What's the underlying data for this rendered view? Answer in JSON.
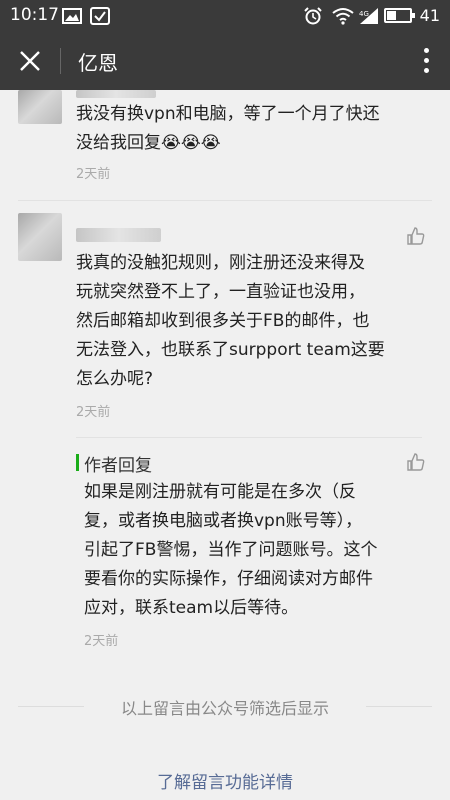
{
  "status_bar": {
    "time": "10:17",
    "signal_label": "4G",
    "battery": "41",
    "battery_level_percent": 41
  },
  "header": {
    "title": "亿恩"
  },
  "comments": [
    {
      "text_lines": [
        "我没有换vpn和电脑，等了一个月了快还",
        "没给我回复😭😭😭"
      ],
      "time": "2天前"
    },
    {
      "text_lines": [
        "我真的没触犯规则，刚注册还没来得及",
        "玩就突然登不上了，一直验证也没用，",
        "然后邮箱却收到很多关于FB的邮件，也",
        "无法登入，也联系了surpport team这要",
        "怎么办呢?"
      ],
      "time": "2天前"
    }
  ],
  "author_reply": {
    "label": "作者回复",
    "text_lines": [
      "如果是刚注册就有可能是在多次（反",
      "复，或者换电脑或者换vpn账号等），",
      "引起了FB警惕，当作了问题账号。这个",
      "要看你的实际操作，仔细阅读对方邮件",
      "应对，联系team以后等待。"
    ],
    "time": "2天前"
  },
  "footer": {
    "note": "以上留言由公众号筛选后显示",
    "link": "了解留言功能详情"
  },
  "colors": {
    "header_bg": "#3a3a3a",
    "page_bg": "#f0f0f0",
    "reply_accent": "#1aad19",
    "link": "#576b95"
  },
  "icons": [
    "close-icon",
    "more-icon",
    "like-icon",
    "wifi-icon",
    "alarm-icon",
    "image-icon",
    "check-icon"
  ]
}
